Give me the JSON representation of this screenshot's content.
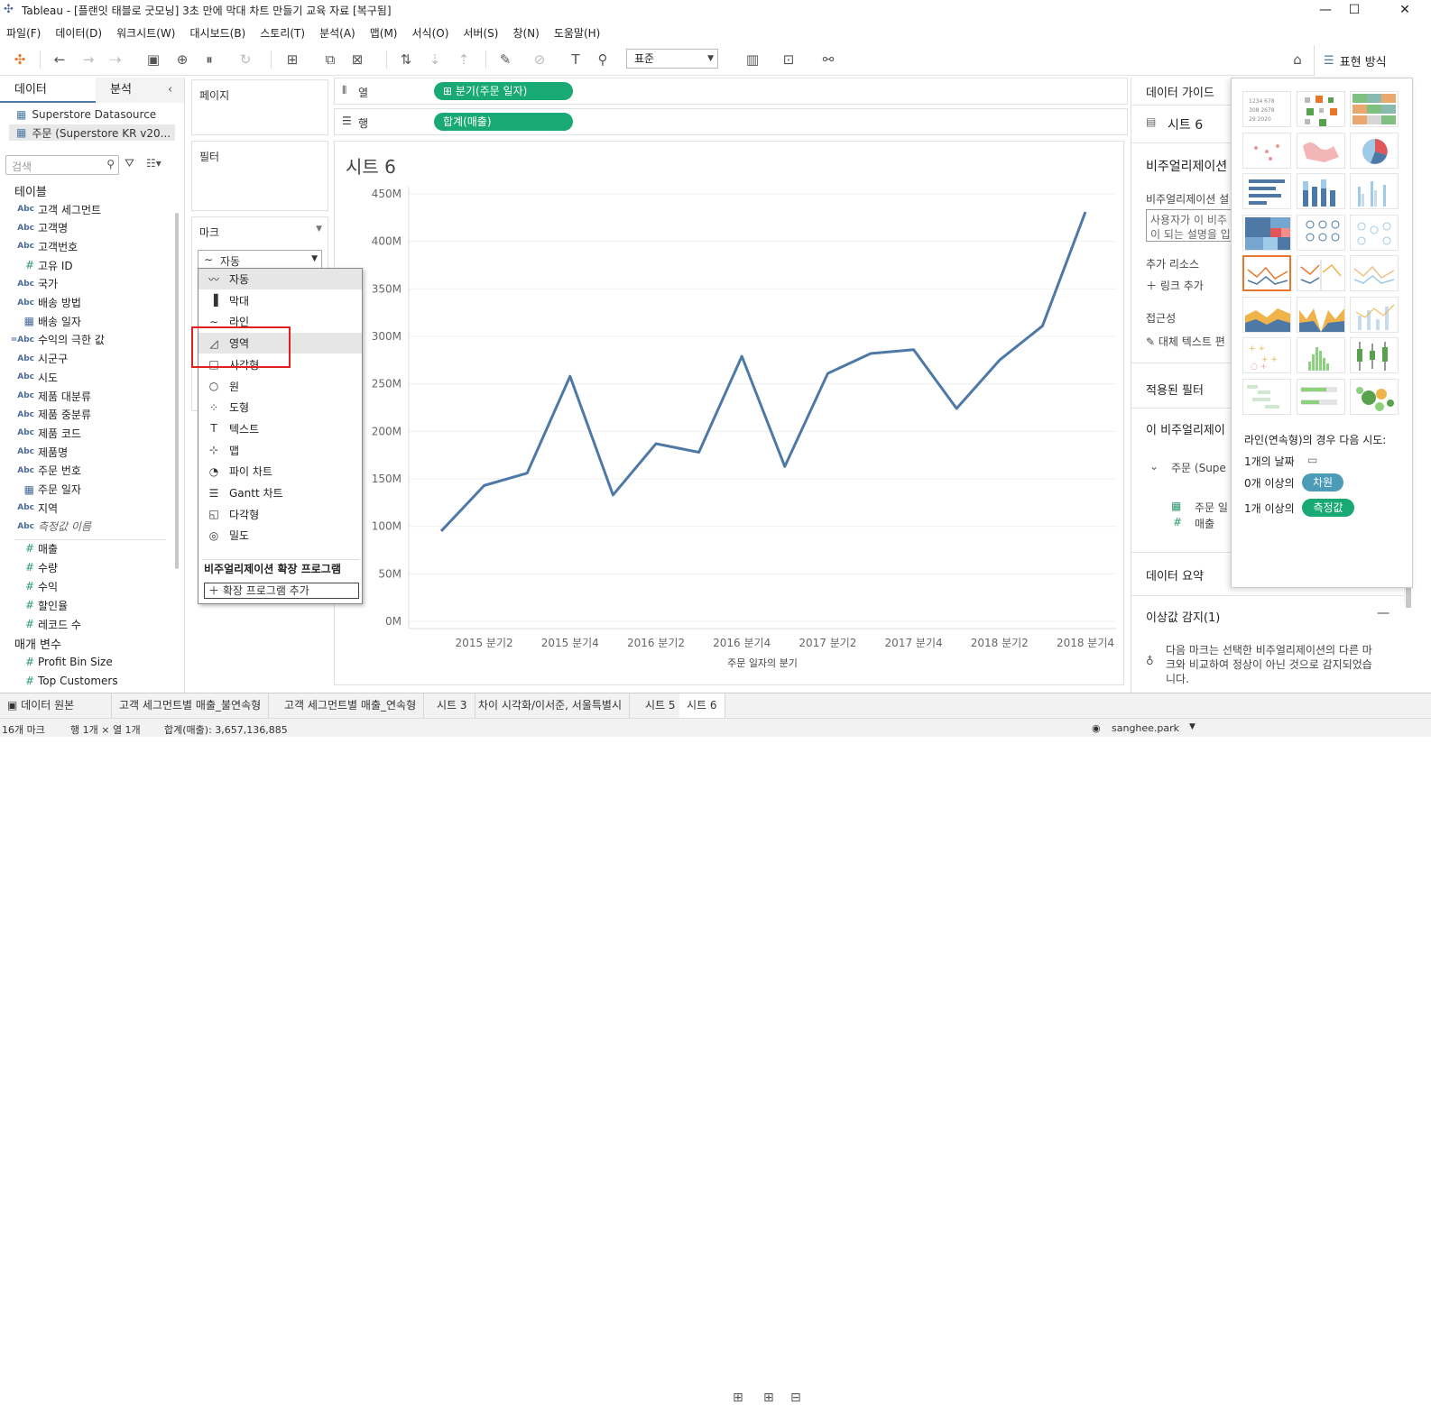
{
  "window": {
    "title": "Tableau - [플랜잇 태블로 굿모닝] 3초 만에 막대 차트 만들기 교육 자료 [복구됨]",
    "minimize": "—",
    "maximize": "☐",
    "close": "✕"
  },
  "menu": [
    "파일(F)",
    "데이터(D)",
    "워크시트(W)",
    "대시보드(B)",
    "스토리(T)",
    "분석(A)",
    "맵(M)",
    "서식(O)",
    "서버(S)",
    "창(N)",
    "도움말(H)"
  ],
  "toolbar": {
    "fit_value": "표준",
    "show_me_label": "표현 방식"
  },
  "data_pane": {
    "tab_data": "데이터",
    "tab_analysis": "분석",
    "datasources": [
      "Superstore Datasource",
      "주문 (Superstore KR v20..."
    ],
    "search_placeholder": "검색",
    "tables_header": "테이블",
    "dimensions": [
      {
        "type": "Abc",
        "name": "고객 세그먼트"
      },
      {
        "type": "Abc",
        "name": "고객명"
      },
      {
        "type": "Abc",
        "name": "고객번호"
      },
      {
        "type": "#",
        "name": "고유 ID"
      },
      {
        "type": "Abc",
        "name": "국가"
      },
      {
        "type": "Abc",
        "name": "배송 방법"
      },
      {
        "type": "date",
        "name": "배송 일자"
      },
      {
        "type": "=Abc",
        "name": "수익의 극한 값"
      },
      {
        "type": "Abc",
        "name": "시군구"
      },
      {
        "type": "Abc",
        "name": "시도"
      },
      {
        "type": "Abc",
        "name": "제품 대분류"
      },
      {
        "type": "Abc",
        "name": "제품 중분류"
      },
      {
        "type": "Abc",
        "name": "제품 코드"
      },
      {
        "type": "Abc",
        "name": "제품명"
      },
      {
        "type": "Abc",
        "name": "주문 번호"
      },
      {
        "type": "date",
        "name": "주문 일자"
      },
      {
        "type": "Abc",
        "name": "지역"
      },
      {
        "type": "Abc",
        "name": "측정값 이름"
      }
    ],
    "measures": [
      "매출",
      "수량",
      "수익",
      "할인율",
      "레코드 수"
    ],
    "parameters_header": "매개 변수",
    "parameters": [
      "Profit Bin Size",
      "Top Customers"
    ]
  },
  "shelves": {
    "pages": "페이지",
    "filters": "필터",
    "marks": "마크",
    "marks_type": "자동",
    "columns_label": "열",
    "rows_label": "행",
    "columns_pill": "분기(주문 일자)",
    "rows_pill": "합계(매출)"
  },
  "mark_dropdown": {
    "items": [
      {
        "icon": "line-chart-icon",
        "glyph": "〰",
        "label": "자동"
      },
      {
        "icon": "bar-chart-icon",
        "glyph": "▐",
        "label": "막대"
      },
      {
        "icon": "line-icon",
        "glyph": "∼",
        "label": "라인"
      },
      {
        "icon": "area-chart-icon",
        "glyph": "◿",
        "label": "영역"
      },
      {
        "icon": "square-icon",
        "glyph": "□",
        "label": "사각형"
      },
      {
        "icon": "circle-icon",
        "glyph": "○",
        "label": "원"
      },
      {
        "icon": "shape-icon",
        "glyph": "⁘",
        "label": "도형"
      },
      {
        "icon": "text-icon",
        "glyph": "T",
        "label": "텍스트"
      },
      {
        "icon": "map-icon",
        "glyph": "⊹",
        "label": "맵"
      },
      {
        "icon": "pie-chart-icon",
        "glyph": "◔",
        "label": "파이 차트"
      },
      {
        "icon": "gantt-chart-icon",
        "glyph": "☰",
        "label": "Gantt 차트"
      },
      {
        "icon": "polygon-icon",
        "glyph": "◱",
        "label": "다각형"
      },
      {
        "icon": "density-icon",
        "glyph": "◎",
        "label": "밀도"
      }
    ],
    "extensions_header": "비주얼리제이션 확장 프로그램",
    "add_extension": "확장 프로그램 추가"
  },
  "sheet": {
    "title": "시트 6"
  },
  "chart_data": {
    "type": "line",
    "x": [
      "2015 분기1",
      "2015 분기2",
      "2015 분기3",
      "2015 분기4",
      "2016 분기1",
      "2016 분기2",
      "2016 분기3",
      "2016 분기4",
      "2017 분기1",
      "2017 분기2",
      "2017 분기3",
      "2017 분기4",
      "2018 분기1",
      "2018 분기2",
      "2018 분기3",
      "2018 분기4"
    ],
    "series": [
      {
        "values": [
          95,
          143,
          156,
          258,
          133,
          187,
          178,
          279,
          163,
          261,
          282,
          286,
          224,
          275,
          311,
          431
        ]
      }
    ],
    "x_tick_labels": [
      "2015 분기2",
      "2015 분기4",
      "2016 분기2",
      "2016 분기4",
      "2017 분기2",
      "2017 분기4",
      "2018 분기2",
      "2018 분기4"
    ],
    "y_ticks": [
      "0M",
      "50M",
      "100M",
      "150M",
      "200M",
      "250M",
      "300M",
      "350M",
      "400M",
      "450M"
    ],
    "xlabel": "주문 일자의 분기",
    "ylim": [
      0,
      450
    ],
    "line_color": "#4e79a7"
  },
  "data_guide": {
    "title": "데이터 가이드",
    "sheet_name": "시트 6",
    "viz_header": "비주얼리제이션",
    "viz_desc_label": "비주얼리제이션 설",
    "viz_desc_placeholder1": "사용자가 이 비주",
    "viz_desc_placeholder2": "이 되는 설명을 입",
    "resources_header": "추가 리소스",
    "add_link": "링크 추가",
    "accessibility_header": "접근성",
    "alt_text": "대체 텍스트 편",
    "filters_header": "적용된 필터",
    "this_viz_header": "이 비주얼리제이",
    "source_item": "주문 (Supe",
    "field_date": "주문 일",
    "field_measure": "매출",
    "summary_header": "데이터 요약",
    "outlier_header": "이상값 감지(1)",
    "outlier_desc1": "다음 마크는 선택한 비주얼리제이션의 다른 마",
    "outlier_desc2": "크와 비교하여 정상이 아닌 것으로 감지되었습",
    "outlier_desc3": "니다."
  },
  "show_me": {
    "hint_title": "라인(연속형)의 경우 다음 시도:",
    "req1": "1개의 날짜",
    "req2_prefix": "0개 이상의",
    "req2_pill": "차원",
    "req3_prefix": "1개 이상의",
    "req3_pill": "측정값",
    "dimension_color": "#4c9bb9",
    "measure_color": "#19a974"
  },
  "sheet_tabs": {
    "datasource": "데이터 원본",
    "tabs": [
      "고객 세그먼트별 매출_불연속형",
      "고객 세그먼트별 매출_연속형",
      "시트 3",
      "차이 시각화/이서준, 서울특별시",
      "시트 5",
      "시트 6"
    ],
    "active": "시트 6"
  },
  "status": {
    "marks": "16개 마크",
    "rows_cols": "행 1개 × 열 1개",
    "sum": "합계(매출): 3,657,136,885",
    "user": "sanghee.park"
  }
}
